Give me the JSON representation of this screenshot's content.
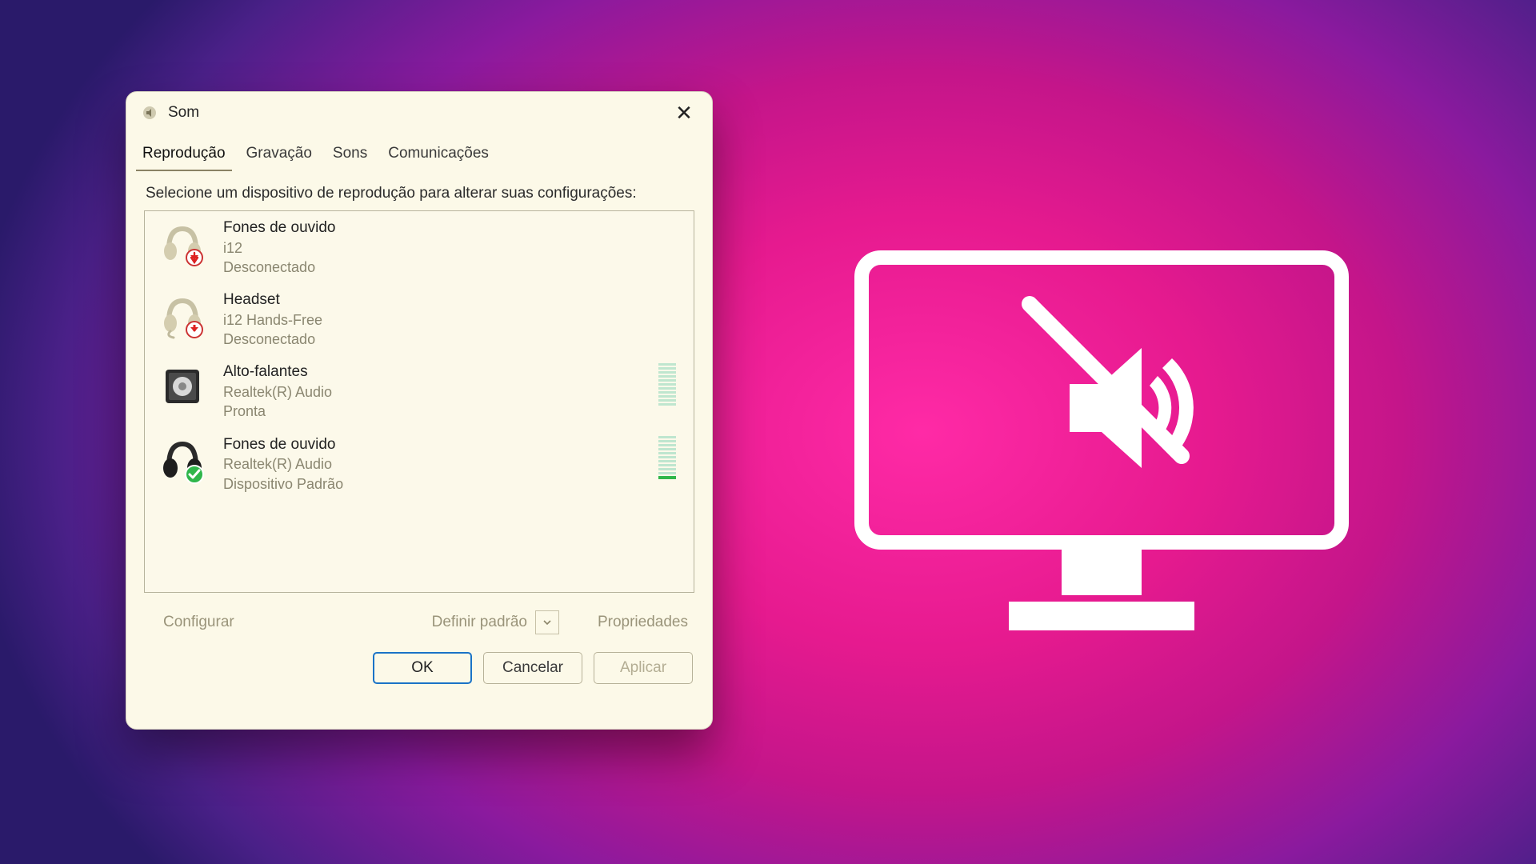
{
  "window": {
    "title": "Som",
    "close_glyph": "✕"
  },
  "tabs": [
    {
      "id": "playback",
      "label": "Reprodução",
      "active": true
    },
    {
      "id": "recording",
      "label": "Gravação",
      "active": false
    },
    {
      "id": "sounds",
      "label": "Sons",
      "active": false
    },
    {
      "id": "communications",
      "label": "Comunicações",
      "active": false
    }
  ],
  "instruction": "Selecione um dispositivo de reprodução para alterar suas configurações:",
  "devices": [
    {
      "icon": "headphones-disconnected",
      "name": "Fones de ouvido",
      "line2": "i12",
      "status": "Desconectado",
      "meter": null
    },
    {
      "icon": "headset-disconnected",
      "name": "Headset",
      "line2": "i12 Hands-Free",
      "status": "Desconectado",
      "meter": null
    },
    {
      "icon": "speaker",
      "name": "Alto-falantes",
      "line2": "Realtek(R) Audio",
      "status": "Pronta",
      "meter": "idle"
    },
    {
      "icon": "headphones-default",
      "name": "Fones de ouvido",
      "line2": "Realtek(R) Audio",
      "status": "Dispositivo Padrão",
      "meter": "active"
    }
  ],
  "buttons": {
    "configure": "Configurar",
    "set_default": "Definir padrão",
    "properties": "Propriedades",
    "ok": "OK",
    "cancel": "Cancelar",
    "apply": "Aplicar"
  },
  "colors": {
    "dialog_bg": "#fcf9e8",
    "accent_blue": "#1a73c7",
    "meter_green": "#2fb64a"
  }
}
